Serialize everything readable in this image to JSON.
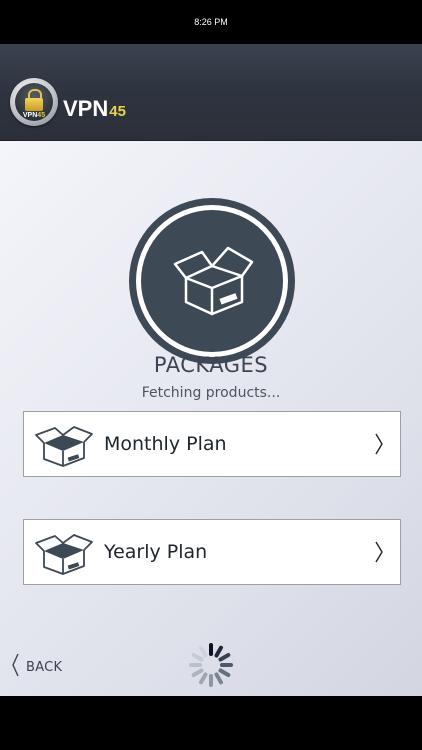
{
  "status_bar": {
    "time": "8:26 PM"
  },
  "header": {
    "logo": {
      "mini_text": "VPN",
      "mini_num": "45"
    },
    "brand_name": "VPN",
    "brand_number": "45"
  },
  "hero": {
    "icon": "open-box-icon"
  },
  "packages": {
    "title": "PACKAGES",
    "status": "Fetching products..."
  },
  "plans": [
    {
      "label": "Monthly Plan",
      "icon": "open-box-icon",
      "action_icon": "chevron-right-icon"
    },
    {
      "label": "Yearly Plan",
      "icon": "open-box-icon",
      "action_icon": "chevron-right-icon"
    }
  ],
  "footer": {
    "back_label": "BACK",
    "back_icon": "chevron-left-icon",
    "loading_icon": "spinner-icon"
  },
  "colors": {
    "header_bg": "#2f3540",
    "accent_yellow": "#e8d44b",
    "hero_bg": "#3d4955",
    "content_bg": "#e6e8f0"
  }
}
